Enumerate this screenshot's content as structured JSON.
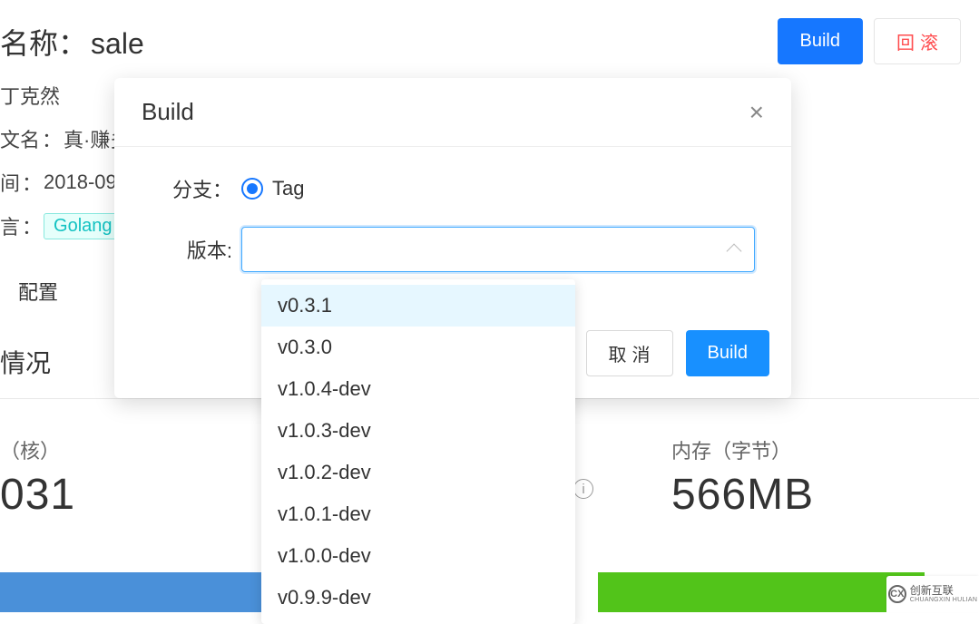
{
  "page": {
    "title_label": "名称",
    "title_value": "sale",
    "build_button": "Build",
    "rollback_button": "回滚"
  },
  "meta": {
    "owner_value": "丁克然",
    "cn_name_label": "文名",
    "cn_name_value": "真·赚多",
    "time_label": "间",
    "time_value": "2018-09",
    "lang_label": "言",
    "lang_value": "Golang"
  },
  "tabs": {
    "config": "配置"
  },
  "section": {
    "usage_title": "情况"
  },
  "stats": {
    "cpu_label": "（核）",
    "cpu_value": "031",
    "mem_label": "内存（字节）",
    "mem_value": "566MB"
  },
  "modal": {
    "title": "Build",
    "branch_label": "分支",
    "branch_radio_label": "Tag",
    "version_label": "版本",
    "cancel_button": "取消",
    "submit_button": "Build"
  },
  "dropdown": {
    "items": [
      "v0.3.1",
      "v0.3.0",
      "v1.0.4-dev",
      "v1.0.3-dev",
      "v1.0.2-dev",
      "v1.0.1-dev",
      "v1.0.0-dev",
      "v0.9.9-dev"
    ],
    "highlight_index": 0
  },
  "watermark": {
    "abbr": "CX",
    "zh": "创新互联",
    "en": "CHUANGXIN HULIAN"
  }
}
